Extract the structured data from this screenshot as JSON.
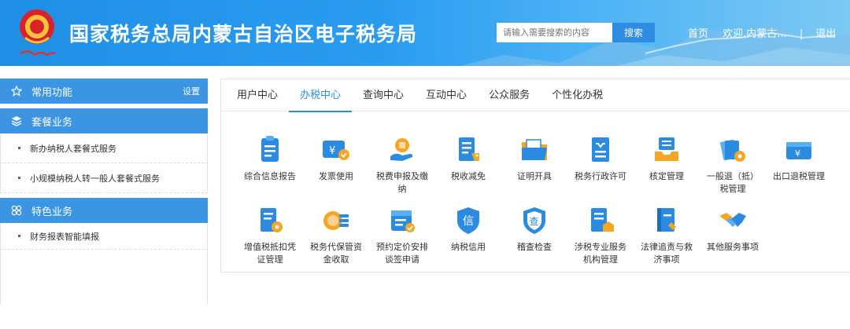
{
  "header": {
    "title": "国家税务总局内蒙古自治区电子税务局",
    "search_placeholder": "请输入需要搜索的内容",
    "search_button": "搜索",
    "links": [
      "首页",
      "欢迎,内蒙古...",
      "|",
      "退出"
    ]
  },
  "sidebar": {
    "common": {
      "label": "常用功能",
      "setting": "设置"
    },
    "package": {
      "label": "套餐业务",
      "items": [
        "新办纳税人套餐式服务",
        "小规模纳税人转一般人套餐式服务"
      ]
    },
    "special": {
      "label": "特色业务",
      "items": [
        "财务报表智能填报"
      ]
    }
  },
  "tabs": [
    "用户中心",
    "办税中心",
    "查询中心",
    "互动中心",
    "公众服务",
    "个性化办税"
  ],
  "active_tab": "办税中心",
  "tiles": [
    {
      "line1": "综合信息报告",
      "line2": ""
    },
    {
      "line1": "发票使用",
      "line2": ""
    },
    {
      "line1": "税费申报及缴",
      "line2": "纳"
    },
    {
      "line1": "税收减免",
      "line2": ""
    },
    {
      "line1": "证明开具",
      "line2": ""
    },
    {
      "line1": "税务行政许可",
      "line2": ""
    },
    {
      "line1": "核定管理",
      "line2": ""
    },
    {
      "line1": "一般退（抵）",
      "line2": "税管理"
    },
    {
      "line1": "出口退税管理",
      "line2": ""
    },
    {
      "line1": "增值税抵扣凭",
      "line2": "证管理"
    },
    {
      "line1": "税务代保管资",
      "line2": "金收取"
    },
    {
      "line1": "预约定价安排",
      "line2": "谈签申请"
    },
    {
      "line1": "纳税信用",
      "line2": ""
    },
    {
      "line1": "稽查检查",
      "line2": ""
    },
    {
      "line1": "涉税专业服务",
      "line2": "机构管理"
    },
    {
      "line1": "法律追责与救",
      "line2": "济事项"
    },
    {
      "line1": "其他服务事项",
      "line2": ""
    }
  ],
  "icon_glyphs": {
    "credit": "信",
    "inspect": "查",
    "invoice": "¥",
    "export": "¥"
  },
  "colors": {
    "accent": "#2c8de0",
    "header": "#2a9cf0",
    "icon_blue": "#2b8be0",
    "icon_orange": "#f5a623"
  }
}
